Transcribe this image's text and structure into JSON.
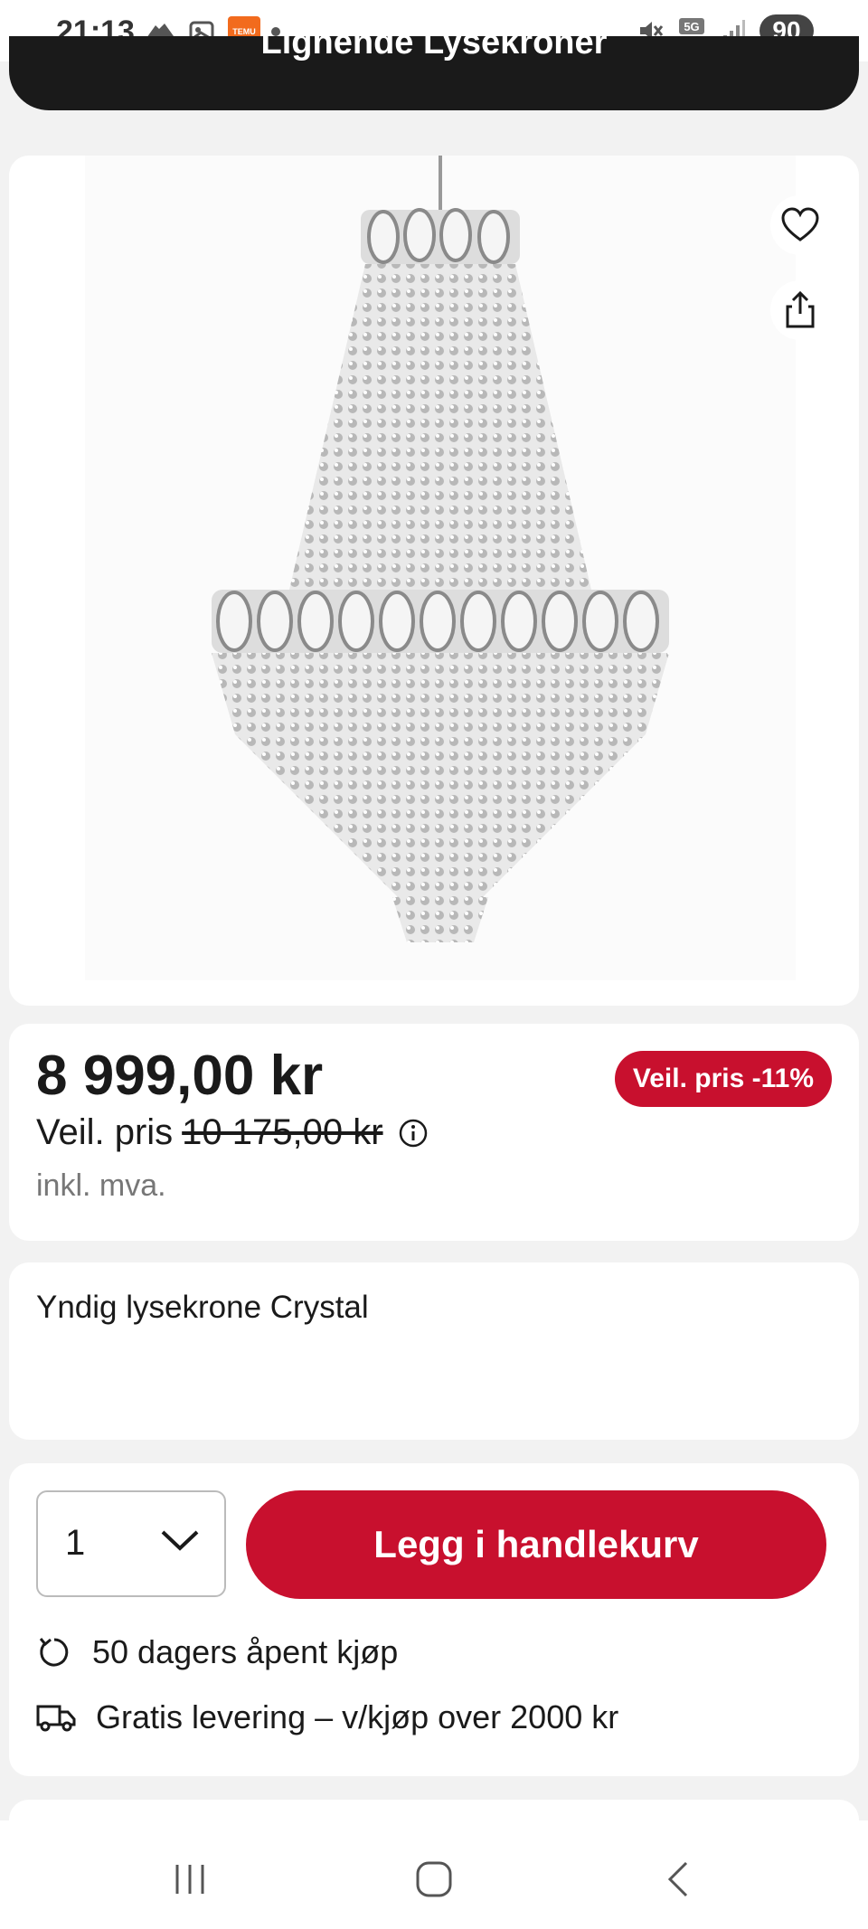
{
  "status_bar": {
    "time": "21:13",
    "battery": "90",
    "network": "5G"
  },
  "header": {
    "similar_title": "Lignende Lysekroner"
  },
  "product": {
    "image_alt": "chandelier-image",
    "price": "8 999,00 kr",
    "ref_price_label": "Veil. pris",
    "ref_price_old": "10 175,00 kr",
    "vat_note": "inkl. mva.",
    "discount_badge": "Veil. pris -11%",
    "title": "Yndig lysekrone Crystal"
  },
  "purchase": {
    "quantity": "1",
    "add_to_cart": "Legg i handlekurv",
    "perks": [
      {
        "icon": "return-icon",
        "label": "50 dagers åpent kjøp"
      },
      {
        "icon": "delivery-truck-icon",
        "label": "Gratis levering – v/kjøp over 2000 kr"
      }
    ]
  },
  "colors": {
    "accent": "#c8102e",
    "dark": "#1a1a1a",
    "background": "#f2f2f2"
  }
}
